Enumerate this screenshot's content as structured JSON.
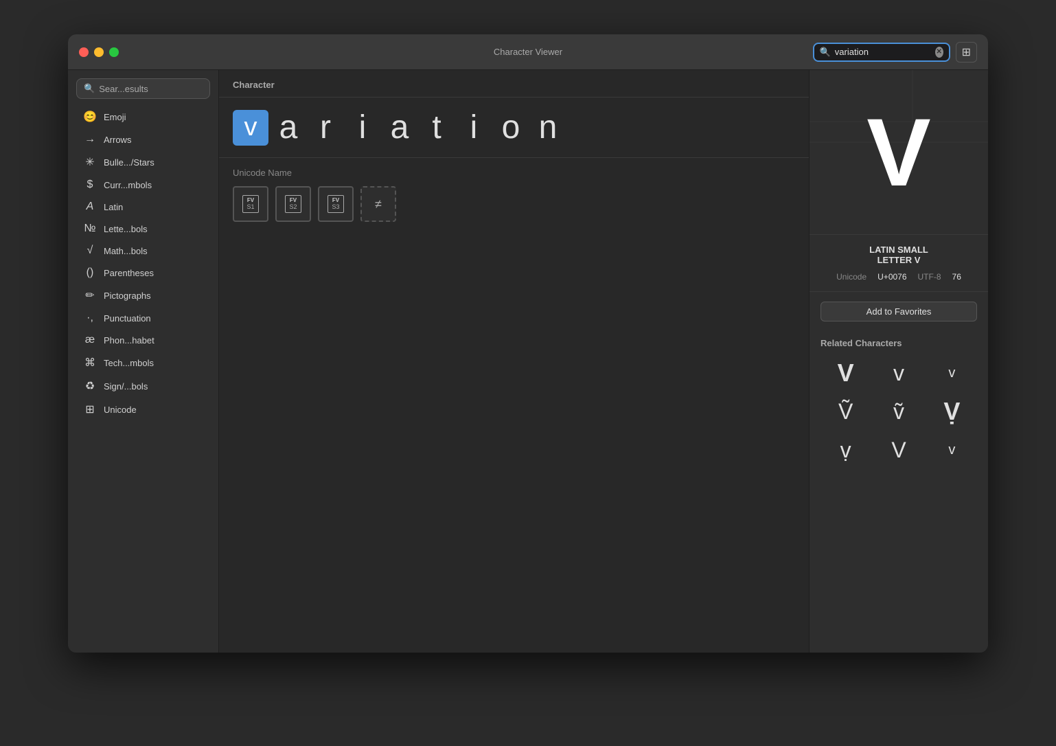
{
  "window": {
    "title": "Character Viewer"
  },
  "titlebar": {
    "search_value": "variation",
    "search_placeholder": "Search"
  },
  "sidebar": {
    "search_label": "Sear...esults",
    "items": [
      {
        "id": "emoji",
        "icon": "😊",
        "label": "Emoji"
      },
      {
        "id": "arrows",
        "icon": "→",
        "label": "Arrows"
      },
      {
        "id": "bullets",
        "icon": "✳",
        "label": "Bulle.../Stars"
      },
      {
        "id": "currency",
        "icon": "$",
        "label": "Curr...mbols"
      },
      {
        "id": "latin",
        "icon": "A",
        "label": "Latin"
      },
      {
        "id": "letterlike",
        "icon": "№",
        "label": "Lette...bols"
      },
      {
        "id": "math",
        "icon": "√",
        "label": "Math...bols"
      },
      {
        "id": "parentheses",
        "icon": "()",
        "label": "Parentheses"
      },
      {
        "id": "pictographs",
        "icon": "✏",
        "label": "Pictographs"
      },
      {
        "id": "punctuation",
        "icon": "·",
        "label": "Punctuation"
      },
      {
        "id": "phonetic",
        "icon": "æ",
        "label": "Phon...habet"
      },
      {
        "id": "technical",
        "icon": "⌘",
        "label": "Tech...mbols"
      },
      {
        "id": "signs",
        "icon": "♻",
        "label": "Sign/...bols"
      },
      {
        "id": "unicode",
        "icon": "⊞",
        "label": "Unicode"
      }
    ]
  },
  "character_panel": {
    "header": "Character",
    "word": "variation",
    "letters": [
      "v",
      "a",
      "r",
      "i",
      "a",
      "t",
      "i",
      "o",
      "n"
    ],
    "selected_letter": "v",
    "unicode_name_label": "Unicode Name",
    "variation_selectors": [
      {
        "label": "FV",
        "num": "S1"
      },
      {
        "label": "FV",
        "num": "S2"
      },
      {
        "label": "FV",
        "num": "S3"
      },
      {
        "label": "≠",
        "num": "",
        "dashed": true
      }
    ]
  },
  "detail_panel": {
    "char": "V",
    "name_line1": "LATIN SMALL",
    "name_line2": "LETTER V",
    "unicode_label": "Unicode",
    "unicode_value": "U+0076",
    "utf8_label": "UTF-8",
    "utf8_value": "76",
    "add_to_favorites": "Add to Favorites",
    "related_label": "Related Characters",
    "related_chars": [
      "V",
      "v",
      "v",
      "Ṽ",
      "ṽ",
      "Ṿ",
      "ṿ",
      "V",
      "v"
    ]
  }
}
